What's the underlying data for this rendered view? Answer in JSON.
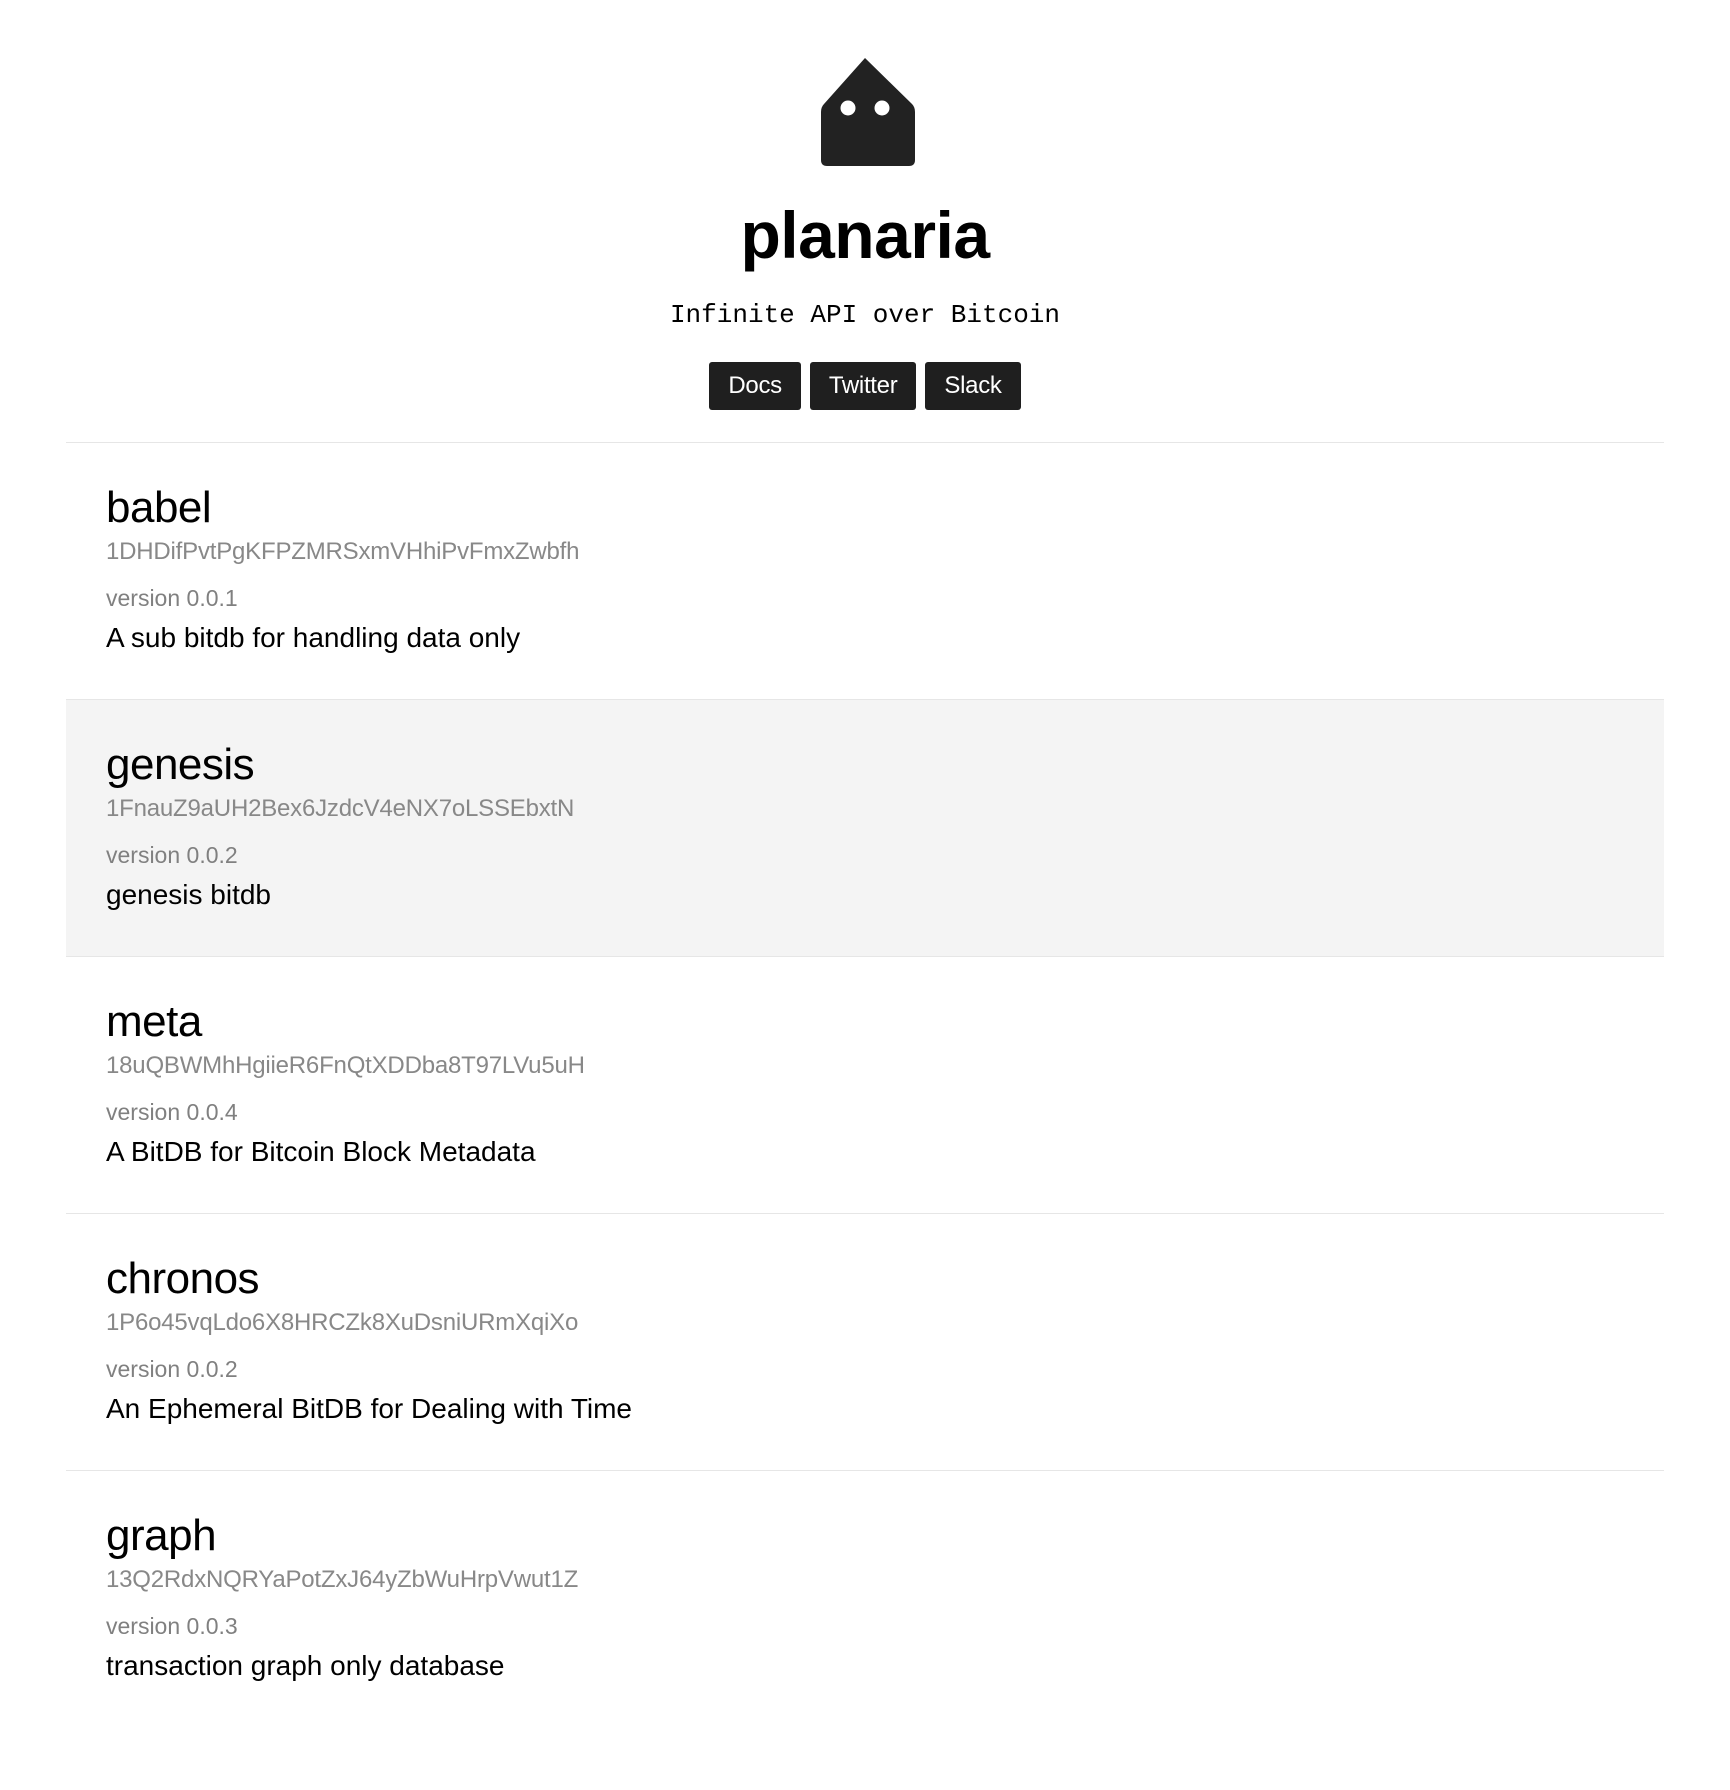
{
  "header": {
    "logo_icon": "house-with-eyes-icon",
    "title": "planaria",
    "tagline": "Infinite API over Bitcoin",
    "nav": [
      {
        "label": "Docs"
      },
      {
        "label": "Twitter"
      },
      {
        "label": "Slack"
      }
    ]
  },
  "items": [
    {
      "name": "babel",
      "address": "1DHDifPvtPgKFPZMRSxmVHhiPvFmxZwbfh",
      "version": "version 0.0.1",
      "description": "A sub bitdb for handling data only",
      "highlighted": false
    },
    {
      "name": "genesis",
      "address": "1FnauZ9aUH2Bex6JzdcV4eNX7oLSSEbxtN",
      "version": "version 0.0.2",
      "description": "genesis bitdb",
      "highlighted": true
    },
    {
      "name": "meta",
      "address": "18uQBWMhHgiieR6FnQtXDDba8T97LVu5uH",
      "version": "version 0.0.4",
      "description": "A BitDB for Bitcoin Block Metadata",
      "highlighted": false
    },
    {
      "name": "chronos",
      "address": "1P6o45vqLdo6X8HRCZk8XuDsniURmXqiXo",
      "version": "version 0.0.2",
      "description": "An Ephemeral BitDB for Dealing with Time",
      "highlighted": false
    },
    {
      "name": "graph",
      "address": "13Q2RdxNQRYaPotZxJ64yZbWuHrpVwut1Z",
      "version": "version 0.0.3",
      "description": "transaction graph only database",
      "highlighted": false
    }
  ],
  "colors": {
    "button_bg": "#1f1f1f",
    "highlight_bg": "#f4f4f4",
    "muted_text": "#888888"
  }
}
